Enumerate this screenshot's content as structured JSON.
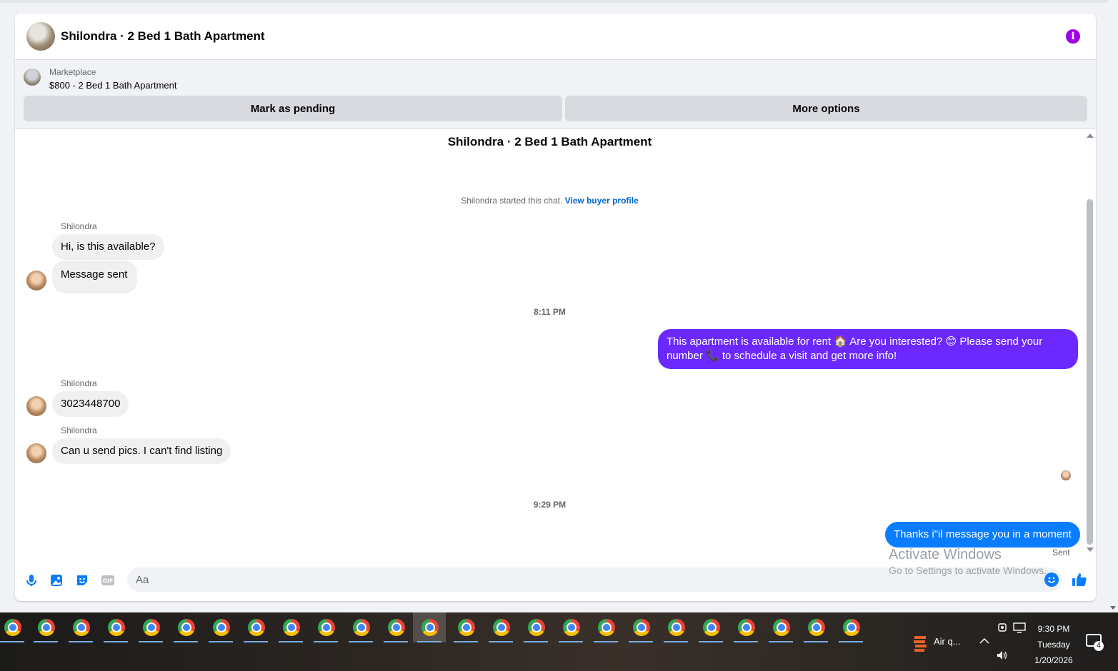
{
  "header": {
    "title": "Shilondra · 2 Bed 1 Bath Apartment",
    "info_icon": "info-icon"
  },
  "marketplace": {
    "label": "Marketplace",
    "listing": "$800 - 2 Bed 1 Bath Apartment",
    "pending_button": "Mark as pending",
    "more_button": "More options"
  },
  "chat": {
    "title": "Shilondra · 2 Bed 1 Bath Apartment",
    "started_text": "Shilondra started this chat.",
    "view_profile": "View buyer profile",
    "messages": [
      {
        "sender": "Shilondra",
        "text": "Hi, is this available?"
      },
      {
        "sender": "",
        "text": "Message sent"
      },
      {
        "timestamp": "8:11 PM"
      },
      {
        "sender": "me",
        "text": "This apartment is available for rent 🏠 Are you interested? 😊 Please send your number 📞 to schedule a visit and get more info!"
      },
      {
        "sender": "Shilondra",
        "text": "3023448700"
      },
      {
        "sender": "Shilondra",
        "text": "Can u send pics. I can't find listing"
      },
      {
        "timestamp": "9:29 PM"
      },
      {
        "sender": "me",
        "text": "Thanks i\"il message you in a moment"
      }
    ],
    "status": "Sent"
  },
  "composer": {
    "placeholder": "Aa",
    "icons": [
      "microphone-icon",
      "image-icon",
      "sticker-icon",
      "gif-icon",
      "emoji-icon",
      "like-icon"
    ]
  },
  "watermark": {
    "line1": "Activate Windows",
    "line2": "Go to Settings to activate Windows."
  },
  "taskbar": {
    "weather": "Air q...",
    "time": "9:30 PM",
    "day": "Tuesday",
    "date": "1/20/2026",
    "notification_count": "4"
  }
}
